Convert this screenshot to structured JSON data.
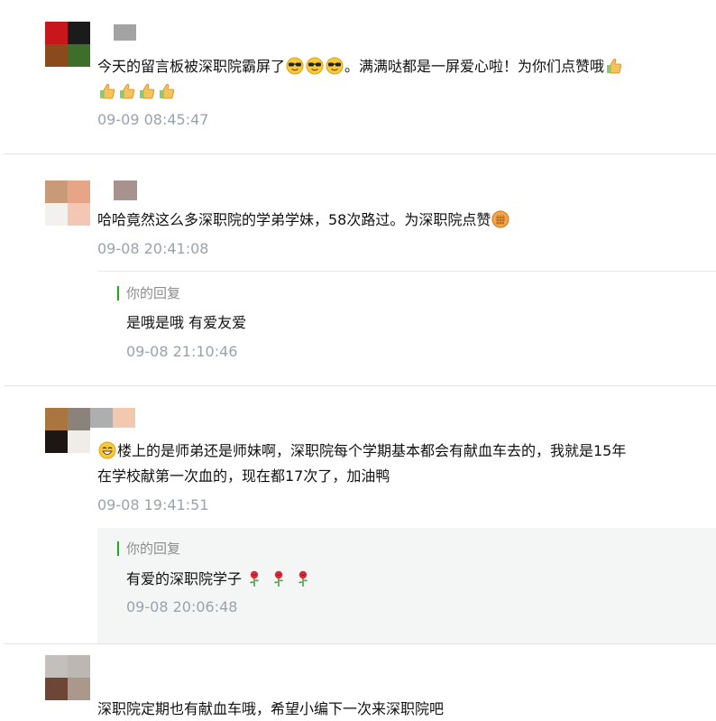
{
  "comments": [
    {
      "segments": [
        "今天的留言板被深职院霸屏了",
        "。满满哒都是一屏爱心啦！为你们点赞哦"
      ],
      "time": "09-09 08:45:47"
    },
    {
      "segments": [
        "哈哈竟然这么多深职院的学弟学妹，58次路过。为深职院点赞"
      ],
      "time": "09-08 20:41:08",
      "reply": {
        "label": "你的回复",
        "text": "是哦是哦 有爱友爱",
        "time": "09-08 21:10:46"
      }
    },
    {
      "segments": [
        "楼上的是师弟还是师妹啊，深职院每个学期基本都会有献血车去的，我就是15年",
        "在学校献第一次血的，现在都17次了，加油鸭"
      ],
      "time": "09-08 19:41:51",
      "reply": {
        "label": "你的回复",
        "text": "有爱的深职院学子",
        "time": "09-08 20:06:48"
      }
    },
    {
      "segments": [
        "深职院定期也有献血车哦，希望小编下一次来深职院吧"
      ]
    }
  ],
  "icons": [
    "cool-sunglasses-emoji",
    "thumbs-up-emoji",
    "fist-emoji",
    "grin-emoji",
    "rose-emoji"
  ],
  "colors": {
    "time": "#9aa3ab",
    "reply_bar": "#1aad19",
    "reply_bg": "#f4f6f6",
    "divider": "#e3e3e3"
  }
}
